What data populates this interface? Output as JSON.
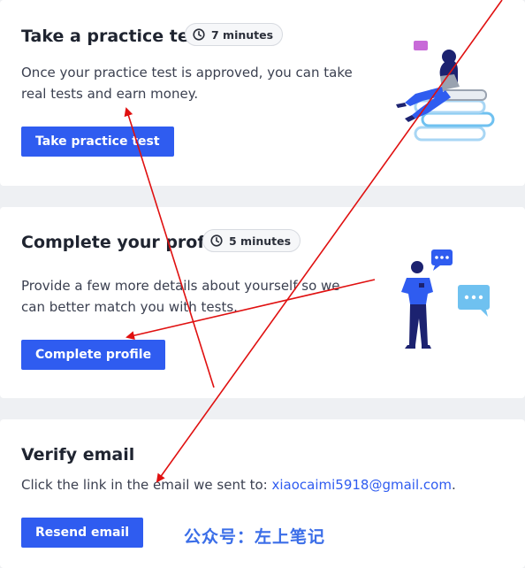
{
  "practice": {
    "title": "Take a practice test",
    "duration": "7 minutes",
    "description": "Once your practice test is approved, you can take real tests and earn money.",
    "button_label": "Take practice test"
  },
  "profile": {
    "title": "Complete your profile",
    "duration": "5 minutes",
    "description": "Provide a few more details about yourself so we can better match you with tests.",
    "button_label": "Complete profile"
  },
  "verify": {
    "title": "Verify email",
    "description_prefix": "Click the link in the email we sent to: ",
    "email": "xiaocaimi5918@gmail.com",
    "email_suffix": ".",
    "button_label": "Resend email"
  },
  "watermark": "公众号：左上笔记",
  "colors": {
    "primary": "#2f5cf0",
    "annotation": "#e01010",
    "illustration_blue": "#2f5cf0",
    "illustration_navy": "#1c2270",
    "illustration_light": "#6fc1f0"
  },
  "icons": [
    "clock-icon",
    "chat-bubble-icon"
  ]
}
